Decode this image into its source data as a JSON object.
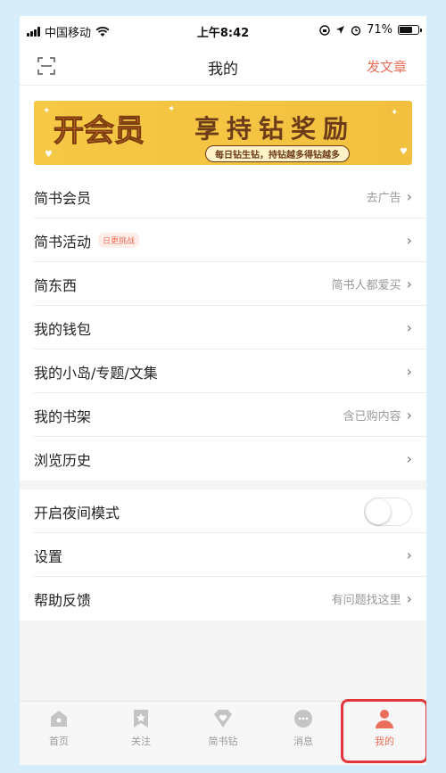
{
  "status": {
    "carrier": "中国移动",
    "time": "上午8:42",
    "battery": "71%",
    "battery_level": 0.71
  },
  "nav": {
    "title": "我的",
    "post_label": "发文章"
  },
  "banner": {
    "main": "开会员",
    "reward": "享持钻奖励",
    "sub": "每日钻生钻，持钻越多得钻越多"
  },
  "menu": [
    {
      "label": "简书会员",
      "hint": "去广告"
    },
    {
      "label": "简书活动",
      "tag": "日更挑战",
      "hint": ""
    },
    {
      "label": "简东西",
      "hint": "简书人都爱买"
    },
    {
      "label": "我的钱包",
      "hint": ""
    },
    {
      "label": "我的小岛/专题/文集",
      "hint": ""
    },
    {
      "label": "我的书架",
      "hint": "含已购内容"
    },
    {
      "label": "浏览历史",
      "hint": ""
    }
  ],
  "settings": [
    {
      "label": "开启夜间模式",
      "toggle_on": false
    },
    {
      "label": "设置",
      "hint": ""
    },
    {
      "label": "帮助反馈",
      "hint": "有问题找这里"
    }
  ],
  "tabs": [
    {
      "label": "首页",
      "icon": "home-icon"
    },
    {
      "label": "关注",
      "icon": "star-bookmark-icon"
    },
    {
      "label": "简书钻",
      "icon": "diamond-heart-icon"
    },
    {
      "label": "消息",
      "icon": "chat-bubble-icon"
    },
    {
      "label": "我的",
      "icon": "person-icon",
      "active": true
    }
  ],
  "colors": {
    "accent": "#ea6f5a",
    "highlight_box": "#e0383a",
    "banner_bg": "#f5c846"
  }
}
